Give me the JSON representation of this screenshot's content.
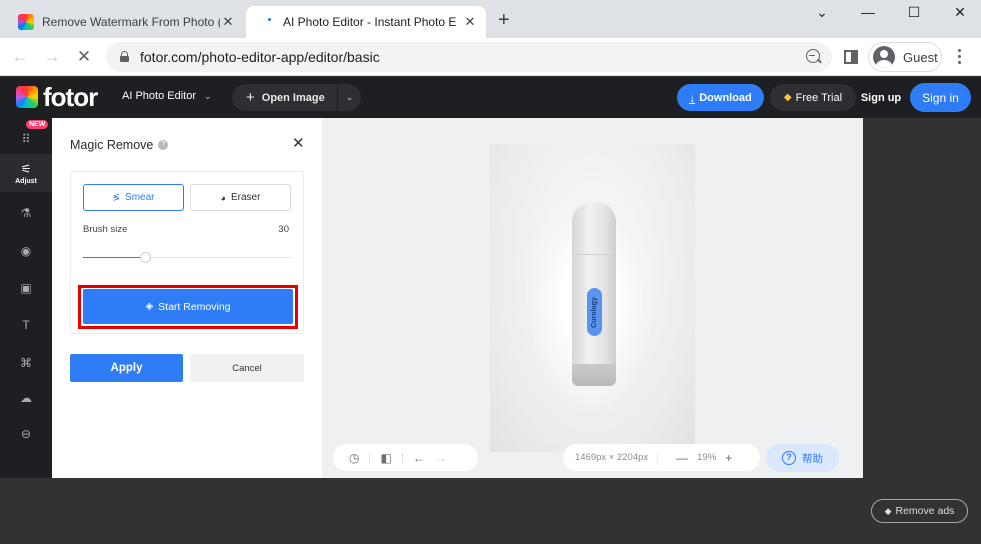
{
  "browser": {
    "tabs": [
      {
        "title": "Remove Watermark From Photo (",
        "active": false
      },
      {
        "title": "AI Photo Editor - Instant Photo E",
        "active": true
      }
    ],
    "new_tab_icon": "+",
    "window_controls": {
      "dropdown": "⌄",
      "minimize": "—",
      "maximize": "☐",
      "close": "✕"
    },
    "url": "fotor.com/photo-editor-app/editor/basic",
    "profile_name": "Guest",
    "nav": {
      "back": "←",
      "forward": "→",
      "stop": "✕"
    }
  },
  "header": {
    "logo_text": "fotor",
    "product_menu": "AI Photo Editor",
    "open_image": "Open Image",
    "download": "Download",
    "free_trial": "Free Trial",
    "sign_up": "Sign up",
    "sign_in": "Sign in"
  },
  "rail": {
    "new_badge": "NEW",
    "items": [
      {
        "name": "apps",
        "label": "",
        "glyph": "⠿"
      },
      {
        "name": "adjust",
        "label": "Adjust",
        "glyph": "⚟",
        "active": true
      },
      {
        "name": "beauty",
        "label": "",
        "glyph": "⚗"
      },
      {
        "name": "effects",
        "label": "",
        "glyph": "◉"
      },
      {
        "name": "frames",
        "label": "",
        "glyph": "▣"
      },
      {
        "name": "text",
        "label": "",
        "glyph": "T"
      },
      {
        "name": "elements",
        "label": "",
        "glyph": "⌘"
      },
      {
        "name": "upload",
        "label": "",
        "glyph": "☁"
      },
      {
        "name": "more",
        "label": "",
        "glyph": "⊖"
      }
    ]
  },
  "panel": {
    "title": "Magic Remove",
    "help_glyph": "?",
    "close_glyph": "✕",
    "modes": [
      {
        "label": "Smear",
        "glyph": "≶",
        "selected": true
      },
      {
        "label": "Eraser",
        "glyph": "◕",
        "selected": false
      }
    ],
    "brush_size_label": "Brush size",
    "brush_size_value": "30",
    "brush_size_fraction": 0.3,
    "start_removing": "Start Removing",
    "apply": "Apply",
    "cancel": "Cancel"
  },
  "canvas": {
    "product_label": "Curology",
    "image_size": "1469px × 2204px",
    "zoom": "19%",
    "zoom_out": "—",
    "zoom_in": "+",
    "help": "帮助",
    "tools": {
      "history": "◷",
      "compare": "◧",
      "undo": "←",
      "redo": "→"
    }
  },
  "footer": {
    "remove_ads": "Remove ads"
  },
  "colors": {
    "accent": "#2e7df6",
    "highlight_box": "#e60000",
    "header_bg": "#1e1f22",
    "new_badge": "#ff3d71",
    "gem": "#ffc738"
  }
}
